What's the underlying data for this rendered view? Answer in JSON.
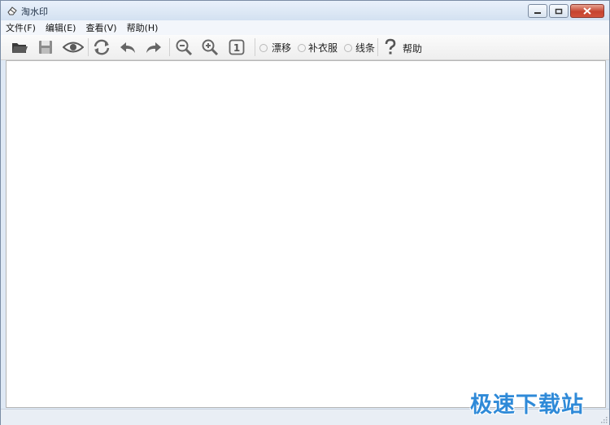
{
  "window": {
    "title": "淘水印",
    "controls": [
      "minimize",
      "maximize",
      "close"
    ]
  },
  "menu": {
    "items": [
      {
        "label": "文件(F)"
      },
      {
        "label": "编辑(E)"
      },
      {
        "label": "查看(V)"
      },
      {
        "label": "帮助(H)"
      }
    ]
  },
  "toolbar": {
    "buttons": [
      {
        "icon": "open-folder-icon"
      },
      {
        "icon": "save-icon"
      },
      {
        "icon": "preview-eye-icon"
      },
      {
        "icon": "refresh-icon"
      },
      {
        "icon": "undo-icon"
      },
      {
        "icon": "redo-icon"
      },
      {
        "icon": "zoom-out-icon"
      },
      {
        "icon": "zoom-in-icon"
      },
      {
        "icon": "actual-size-icon",
        "text": "1"
      }
    ],
    "modes": [
      {
        "label": "漂移"
      },
      {
        "label": "补衣服"
      },
      {
        "label": "线条"
      }
    ],
    "help_label": "帮助"
  },
  "watermark": {
    "text": "极速下载站"
  },
  "colors": {
    "accent": "#2f8ad8",
    "titlebar": "#dfe9f5"
  }
}
